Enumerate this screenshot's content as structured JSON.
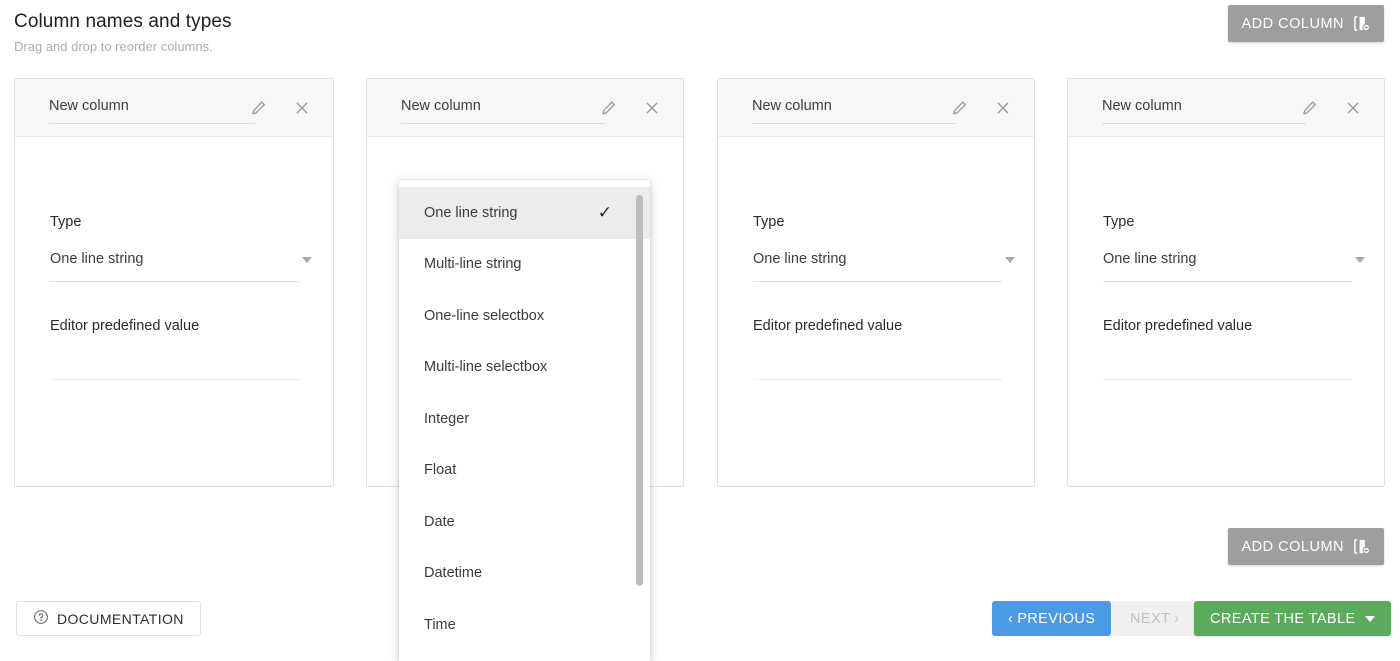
{
  "header": {
    "title": "Column names and types",
    "subtitle": "Drag and drop to reorder columns."
  },
  "toolbar": {
    "add_column_top_label": "ADD COLUMN",
    "add_column_bottom_label": "ADD COLUMN",
    "add_column_icon": "add-column-icon"
  },
  "labels": {
    "type": "Type",
    "editor_predefined_value": "Editor predefined value",
    "edit_icon": "pencil-icon",
    "close_icon": "close-icon",
    "dropdown_caret_icon": "chevron-down-icon"
  },
  "columns": [
    {
      "name": "New column",
      "type_value": "One line string",
      "editor_value": ""
    },
    {
      "name": "New column",
      "type_value": "One line string",
      "editor_value": ""
    },
    {
      "name": "New column",
      "type_value": "One line string",
      "editor_value": ""
    },
    {
      "name": "New column",
      "type_value": "One line string",
      "editor_value": ""
    }
  ],
  "dropdown": {
    "open_for_column_index": 1,
    "selected": "One line string",
    "check_icon": "✓",
    "items": [
      {
        "label": "One line string",
        "selected": true
      },
      {
        "label": "Multi-line string",
        "selected": false
      },
      {
        "label": "One-line selectbox",
        "selected": false
      },
      {
        "label": "Multi-line selectbox",
        "selected": false
      },
      {
        "label": "Integer",
        "selected": false
      },
      {
        "label": "Float",
        "selected": false
      },
      {
        "label": "Date",
        "selected": false
      },
      {
        "label": "Datetime",
        "selected": false
      },
      {
        "label": "Time",
        "selected": false
      }
    ]
  },
  "footer": {
    "documentation_label": "DOCUMENTATION",
    "documentation_icon": "help-circle-icon",
    "previous_label": "PREVIOUS",
    "previous_icon": "‹",
    "next_label": "NEXT",
    "next_icon": "›",
    "create_label": "CREATE THE TABLE"
  },
  "colors": {
    "add_column_bg": "#9e9e9e",
    "previous_bg": "#4a9ae8",
    "next_bg": "#f0f0f0",
    "create_bg": "#5cab5c",
    "card_header_bg": "#f7f7f7",
    "dropdown_selected_bg": "#ececec"
  }
}
